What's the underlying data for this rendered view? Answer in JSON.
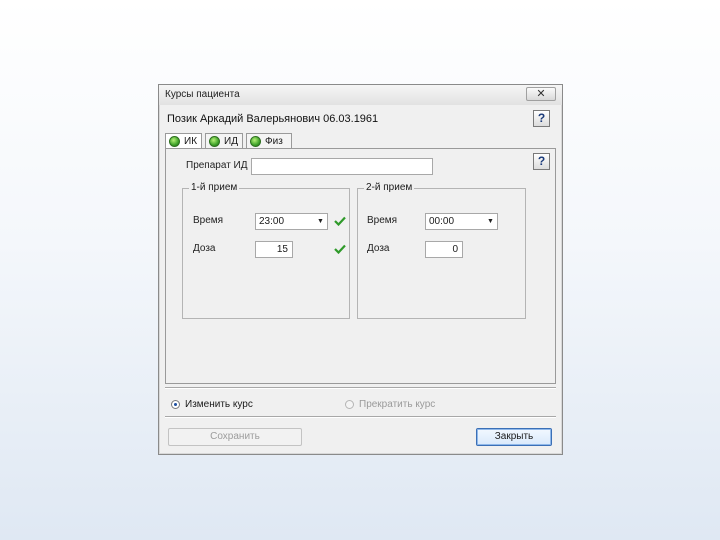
{
  "window": {
    "title": "Курсы пациента",
    "close_label": "✕",
    "help_label": "?"
  },
  "patient": {
    "full_name": "Позик Аркадий Валерьянович 06.03.1961"
  },
  "tabs": [
    {
      "label": "ИК",
      "status_color": "#3fa32a"
    },
    {
      "label": "ИД",
      "status_color": "#3fa32a"
    },
    {
      "label": "Физ",
      "status_color": "#3fa32a"
    }
  ],
  "form": {
    "drug_label": "Препарат ИД",
    "drug_value": "",
    "first_dose": {
      "title": "1-й прием",
      "time_label": "Время",
      "time_value": "23:00",
      "dose_label": "Доза",
      "dose_value": "15",
      "check_icon": "check-icon"
    },
    "second_dose": {
      "title": "2-й прием",
      "time_label": "Время",
      "time_value": "00:00",
      "dose_label": "Доза",
      "dose_value": "0"
    }
  },
  "options": {
    "change_course": "Изменить курс",
    "stop_course": "Прекратить курс",
    "selected": "change_course"
  },
  "buttons": {
    "save": "Сохранить",
    "close": "Закрыть"
  },
  "colors": {
    "status_ok": "#3fa32a",
    "check": "#2f9a2a",
    "default_button_border": "#3b6fb6"
  }
}
